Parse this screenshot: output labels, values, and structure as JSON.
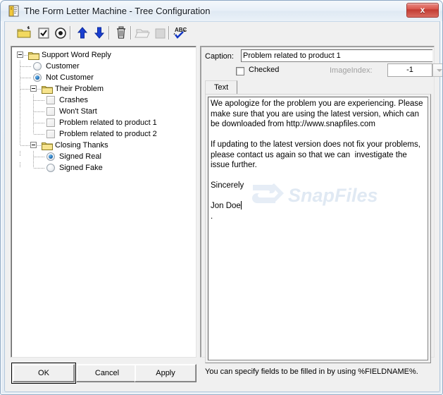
{
  "window": {
    "title": "The Form Letter Machine - Tree Configuration",
    "close_label": "x",
    "app_icon": "form-letter-icon"
  },
  "toolbar": {
    "buttons": [
      {
        "name": "new-folder-icon",
        "tooltip": "New Folder",
        "enabled": true
      },
      {
        "name": "new-checkbox-icon",
        "tooltip": "New Checkbox",
        "enabled": true
      },
      {
        "name": "new-radio-icon",
        "tooltip": "New Radio",
        "enabled": true
      },
      {
        "name": "move-up-icon",
        "tooltip": "Move Up",
        "enabled": true
      },
      {
        "name": "move-down-icon",
        "tooltip": "Move Down",
        "enabled": true
      },
      {
        "name": "delete-trash-icon",
        "tooltip": "Delete",
        "enabled": true
      },
      {
        "name": "open-folder-icon",
        "tooltip": "Open",
        "enabled": false
      },
      {
        "name": "stop-square-icon",
        "tooltip": "Stop",
        "enabled": false
      },
      {
        "name": "spellcheck-abc-icon",
        "tooltip": "Spell Check",
        "enabled": true
      }
    ]
  },
  "tree": {
    "nodes": [
      {
        "label": "Support Word Reply",
        "type": "folder",
        "depth": 0,
        "expanded": true,
        "selected": false
      },
      {
        "label": "Customer",
        "type": "radio",
        "depth": 1,
        "checked": false,
        "selected": false
      },
      {
        "label": "Not Customer",
        "type": "radio",
        "depth": 1,
        "checked": true,
        "selected": false
      },
      {
        "label": "Their Problem",
        "type": "folder",
        "depth": 1,
        "expanded": true,
        "selected": false
      },
      {
        "label": "Crashes",
        "type": "checkbox",
        "depth": 2,
        "checked": false,
        "selected": false
      },
      {
        "label": "Won't Start",
        "type": "checkbox",
        "depth": 2,
        "checked": false,
        "selected": false
      },
      {
        "label": "Problem related to product 1",
        "type": "checkbox",
        "depth": 2,
        "checked": false,
        "selected": true
      },
      {
        "label": "Problem related to product 2",
        "type": "checkbox",
        "depth": 2,
        "checked": false,
        "selected": false
      },
      {
        "label": "Closing Thanks",
        "type": "folder",
        "depth": 1,
        "expanded": true,
        "selected": false
      },
      {
        "label": "Signed Real",
        "type": "radio",
        "depth": 2,
        "checked": true,
        "selected": false
      },
      {
        "label": "Signed Fake",
        "type": "radio",
        "depth": 2,
        "checked": false,
        "selected": false
      }
    ]
  },
  "details": {
    "caption_label": "Caption:",
    "caption_value": "Problem related to product 1",
    "checked_label": "Checked",
    "checked_value": false,
    "imageindex_label": "ImageIndex:",
    "imageindex_value": "-1",
    "imageindex_enabled": false,
    "tabs": [
      {
        "label": "Text",
        "active": true
      }
    ],
    "text_body": "We apologize for the problem you are experiencing. Please make sure that you are using the latest version, which can be downloaded from http://www.snapfiles.com\n\nIf updating to the latest version does not fix your problems, please contact us again so that we can  investigate the issue further.\n\nSincerely\n\nJon Doe",
    "text_trailing_line": ".",
    "hint": "You can specify fields to be filled in by using %FIELDNAME%.",
    "watermark": "SnapFiles"
  },
  "footer": {
    "ok_label": "OK",
    "cancel_label": "Cancel",
    "apply_label": "Apply"
  },
  "colors": {
    "accent_blue": "#1f6fb5",
    "close_red": "#c23b32",
    "folder_yellow": "#f5e07a",
    "watermark_blue": "#dde7f2",
    "window_border": "#8ea8c4",
    "face": "#f0f0f0"
  }
}
